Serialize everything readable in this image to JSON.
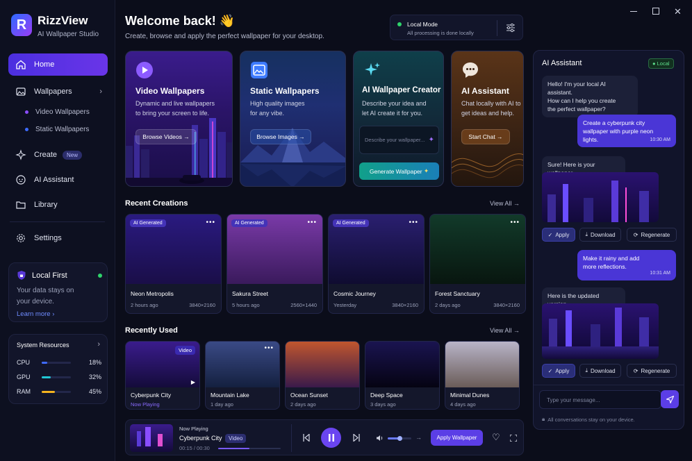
{
  "window": {
    "min": "—",
    "max": "☐",
    "close": "✕"
  },
  "app": {
    "name": "RizzView",
    "subtitle": "AI Wallpaper Studio",
    "logo_letter": "R"
  },
  "nav": {
    "home": "Home",
    "wallpapers": "Wallpapers",
    "video_wallpapers": "Video Wallpapers",
    "static_wallpapers": "Static Wallpapers",
    "create": "Create",
    "create_badge": "New",
    "ai_assistant": "AI Assistant",
    "library": "Library",
    "settings": "Settings"
  },
  "local_first": {
    "title": "Local First",
    "text1": "Your data stays on",
    "text2": "your device.",
    "link": "Learn more"
  },
  "resources": {
    "title": "System Resources",
    "items": [
      {
        "label": "CPU",
        "value": "18%",
        "level": 0.18,
        "color": "#3f6bff"
      },
      {
        "label": "GPU",
        "value": "32%",
        "level": 0.32,
        "color": "#22c7d6"
      },
      {
        "label": "RAM",
        "value": "45%",
        "level": 0.45,
        "color": "#f4b31e"
      }
    ]
  },
  "header": {
    "title": "Welcome back! 👋",
    "subtitle": "Create, browse and apply the perfect wallpaper for your desktop."
  },
  "mode": {
    "title": "Local Mode",
    "text": "All processing is done locally"
  },
  "features": [
    {
      "title": "Video Wallpapers",
      "desc1": "Dynamic and live wallpapers",
      "desc2": "to bring your screen to life.",
      "button": "Browse Videos →"
    },
    {
      "title": "Static Wallpapers",
      "desc1": "High quality images",
      "desc2": "for any vibe.",
      "button": "Browse Images →"
    },
    {
      "title": "AI Wallpaper Creator",
      "desc1": "Describe your idea and",
      "desc2": "let AI create it for you.",
      "input_placeholder": "Describe your wallpaper...",
      "button": "Generate Wallpaper"
    },
    {
      "title": "AI Assistant",
      "desc1": "Chat locally with AI to",
      "desc2": "get ideas and help.",
      "button": "Start Chat →"
    }
  ],
  "recent": {
    "title": "Recent Creations",
    "view_all": "View All →",
    "tag": "AI Generated",
    "items": [
      {
        "name": "Neon Metropolis",
        "time": "2 hours ago",
        "res": "3840×2160"
      },
      {
        "name": "Sakura Street",
        "time": "5 hours ago",
        "res": "2560×1440"
      },
      {
        "name": "Cosmic Journey",
        "time": "Yesterday",
        "res": "3840×2160"
      },
      {
        "name": "Forest Sanctuary",
        "time": "2 days ago",
        "res": "3840×2160"
      }
    ]
  },
  "used": {
    "title": "Recently Used",
    "view_all": "View All →",
    "video_tag": "Video",
    "items": [
      {
        "name": "Cyberpunk City",
        "time": "Now Playing"
      },
      {
        "name": "Mountain Lake",
        "time": "1 day ago"
      },
      {
        "name": "Ocean Sunset",
        "time": "2 days ago"
      },
      {
        "name": "Deep Space",
        "time": "3 days ago"
      },
      {
        "name": "Minimal Dunes",
        "time": "4 days ago"
      }
    ]
  },
  "player": {
    "label": "Now Playing",
    "title": "Cyberpunk City",
    "tag": "Video",
    "time": "00:15 / 00:30",
    "progress": 0.5,
    "volume": 0.5,
    "apply": "Apply Wallpaper"
  },
  "chat": {
    "title": "AI Assistant",
    "badge": "Local",
    "m1": [
      "Hello! I'm your local AI assistant.",
      "How can I help you create",
      "the perfect wallpaper?"
    ],
    "m2": [
      "Create a cyberpunk city",
      "wallpaper with purple neon",
      "lights."
    ],
    "m2_time": "10:30 AM",
    "m3": "Sure! Here is your wallpaper.",
    "m4": [
      "Make it rainy and add",
      "more reflections."
    ],
    "m4_time": "10:31 AM",
    "m5": "Here is the updated version.",
    "apply": "Apply",
    "download": "Download",
    "regenerate": "Regenerate",
    "input_placeholder": "Type your message...",
    "footer": "All conversations stay on your device."
  }
}
